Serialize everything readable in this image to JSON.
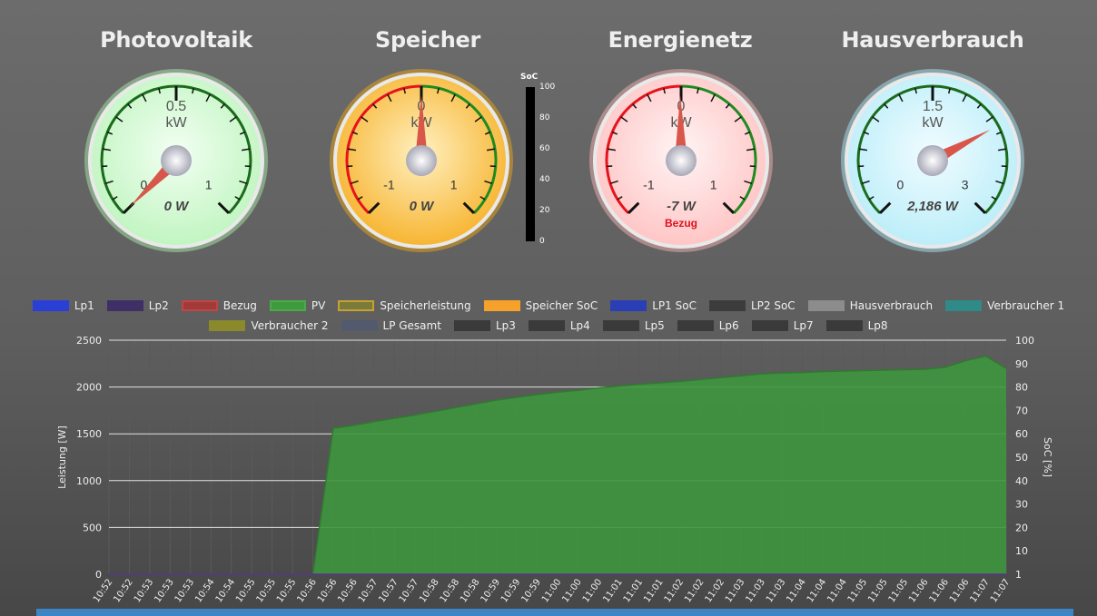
{
  "gauges": [
    {
      "title": "Photovoltaik",
      "center_label": "0.5",
      "unit": "kW",
      "min_label": "0",
      "max_label": "1",
      "value_text": "0 W",
      "status": "",
      "face": "#c2f5c2",
      "face_light": "#f2fff2",
      "rim": "#9fd29f",
      "needle_fraction": 0.0,
      "scale": "positive"
    },
    {
      "title": "Speicher",
      "center_label": "0",
      "unit": "kW",
      "min_label": "-1",
      "max_label": "1",
      "value_text": "0 W",
      "status": "",
      "face": "#f7b634",
      "face_light": "#fff0c0",
      "rim": "#d69a20",
      "needle_fraction": 0.5,
      "scale": "bipolar"
    },
    {
      "title": "Energienetz",
      "center_label": "0",
      "unit": "kW",
      "min_label": "-1",
      "max_label": "1",
      "value_text": "-7 W",
      "status": "Bezug",
      "face": "#ffc6c6",
      "face_light": "#fff4f4",
      "rim": "#d9a3a3",
      "needle_fraction": 0.497,
      "scale": "bipolar"
    },
    {
      "title": "Hausverbrauch",
      "center_label": "1.5",
      "unit": "kW",
      "min_label": "0",
      "max_label": "3",
      "value_text": "2,186 W",
      "status": "",
      "face": "#bdeef9",
      "face_light": "#f0fcff",
      "rim": "#9ccfdb",
      "needle_fraction": 0.729,
      "scale": "positive"
    }
  ],
  "soc_bar": {
    "title": "SoC",
    "ticks": [
      "100",
      "80",
      "60",
      "40",
      "20",
      "0"
    ]
  },
  "legend_row1": [
    {
      "label": "Lp1",
      "color": "#2a3fd6",
      "border": "#2a3fd6"
    },
    {
      "label": "Lp2",
      "color": "#3e2f66",
      "border": "#3e2f66"
    },
    {
      "label": "Bezug",
      "color": "#a33a3a",
      "border": "#c04545"
    },
    {
      "label": "PV",
      "color": "#3d9a3d",
      "border": "#4aaa4a"
    },
    {
      "label": "Speicherleistung",
      "color": "#7a7a3a",
      "border": "#c6a030"
    },
    {
      "label": "Speicher SoC",
      "color": "#f6a22a",
      "border": "#f6a22a"
    },
    {
      "label": "LP1 SoC",
      "color": "#2a3fb6",
      "border": "#2a3fb6"
    },
    {
      "label": "LP2 SoC",
      "color": "#3c3c3c",
      "border": "#3c3c3c"
    },
    {
      "label": "Hausverbrauch",
      "color": "#8c8c8c",
      "border": "#8c8c8c"
    },
    {
      "label": "Verbraucher 1",
      "color": "#2f8a88",
      "border": "#2f8a88"
    }
  ],
  "legend_row2": [
    {
      "label": "Verbraucher 2",
      "color": "#8a8a2c",
      "border": "#8a8a2c"
    },
    {
      "label": "LP Gesamt",
      "color": "#535a6e",
      "border": "#535a6e"
    },
    {
      "label": "Lp3",
      "color": "#3a3a3a",
      "border": "#3a3a3a"
    },
    {
      "label": "Lp4",
      "color": "#3a3a3a",
      "border": "#3a3a3a"
    },
    {
      "label": "Lp5",
      "color": "#3a3a3a",
      "border": "#3a3a3a"
    },
    {
      "label": "Lp6",
      "color": "#3a3a3a",
      "border": "#3a3a3a"
    },
    {
      "label": "Lp7",
      "color": "#3a3a3a",
      "border": "#3a3a3a"
    },
    {
      "label": "Lp8",
      "color": "#3a3a3a",
      "border": "#3a3a3a"
    }
  ],
  "chart_data": {
    "type": "area",
    "ylabel": "Leistung [W]",
    "y2label": "SoC [%]",
    "ylim": [
      0,
      2500
    ],
    "yticks": [
      "0",
      "500",
      "1000",
      "1500",
      "2000",
      "2500"
    ],
    "y2ticks": [
      "1",
      "10",
      "20",
      "30",
      "40",
      "50",
      "60",
      "70",
      "80",
      "90",
      "100"
    ],
    "x": [
      "10:52",
      "10:52",
      "10:53",
      "10:53",
      "10:53",
      "10:54",
      "10:54",
      "10:55",
      "10:55",
      "10:55",
      "10:56",
      "10:56",
      "10:56",
      "10:57",
      "10:57",
      "10:57",
      "10:58",
      "10:58",
      "10:58",
      "10:59",
      "10:59",
      "10:59",
      "11:00",
      "11:00",
      "11:00",
      "11:01",
      "11:01",
      "11:01",
      "11:02",
      "11:02",
      "11:02",
      "11:03",
      "11:03",
      "11:03",
      "11:04",
      "11:04",
      "11:04",
      "11:05",
      "11:05",
      "11:05",
      "11:06",
      "11:06",
      "11:06",
      "11:07",
      "11:07"
    ],
    "series": [
      {
        "name": "PV",
        "color": "#3e963e",
        "values": [
          0,
          0,
          0,
          0,
          0,
          0,
          0,
          0,
          0,
          0,
          0,
          1560,
          1590,
          1630,
          1665,
          1700,
          1740,
          1780,
          1820,
          1860,
          1890,
          1920,
          1945,
          1965,
          1990,
          2010,
          2030,
          2045,
          2060,
          2080,
          2100,
          2120,
          2140,
          2150,
          2155,
          2165,
          2170,
          2175,
          2180,
          2185,
          2190,
          2210,
          2280,
          2330,
          2200
        ]
      },
      {
        "name": "Lp2",
        "color": "#5a2f8f",
        "values": [
          0,
          0,
          0,
          0,
          0,
          0,
          0,
          0,
          0,
          0,
          0,
          0,
          0,
          0,
          0,
          0,
          0,
          0,
          0,
          0,
          0,
          0,
          0,
          0,
          0,
          0,
          0,
          0,
          0,
          0,
          0,
          0,
          0,
          0,
          0,
          0,
          0,
          0,
          0,
          0,
          0,
          0,
          0,
          0,
          0
        ]
      }
    ]
  }
}
